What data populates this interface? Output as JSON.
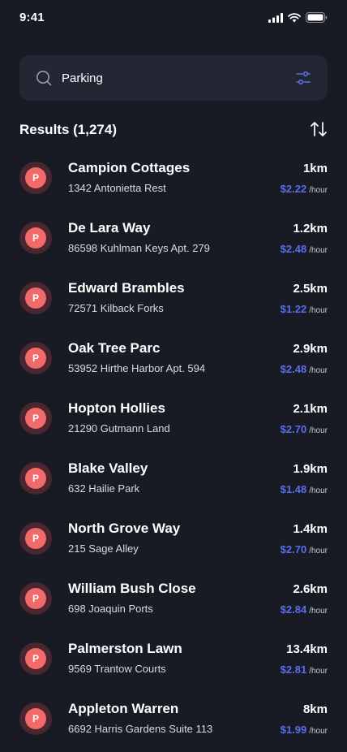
{
  "status_bar": {
    "time": "9:41"
  },
  "search": {
    "value": "Parking"
  },
  "results": {
    "title": "Results (1,274)"
  },
  "colors": {
    "background": "#181b24",
    "card": "#232734",
    "accent": "#5b6cf0",
    "pin": "#f26b6b"
  },
  "icons": {
    "pin_letter": "P"
  },
  "items": [
    {
      "name": "Campion Cottages",
      "address": "1342 Antonietta Rest",
      "distance": "1km",
      "price": "$2.22",
      "unit": "/hour"
    },
    {
      "name": "De Lara Way",
      "address": "86598 Kuhlman Keys Apt. 279",
      "distance": "1.2km",
      "price": "$2.48",
      "unit": "/hour"
    },
    {
      "name": "Edward Brambles",
      "address": "72571 Kilback Forks",
      "distance": "2.5km",
      "price": "$1.22",
      "unit": "/hour"
    },
    {
      "name": "Oak Tree Parc",
      "address": "53952 Hirthe Harbor Apt. 594",
      "distance": "2.9km",
      "price": "$2.48",
      "unit": "/hour"
    },
    {
      "name": "Hopton Hollies",
      "address": "21290 Gutmann Land",
      "distance": "2.1km",
      "price": "$2.70",
      "unit": "/hour"
    },
    {
      "name": "Blake Valley",
      "address": "632 Hailie Park",
      "distance": "1.9km",
      "price": "$1.48",
      "unit": "/hour"
    },
    {
      "name": "North Grove Way",
      "address": "215 Sage Alley",
      "distance": "1.4km",
      "price": "$2.70",
      "unit": "/hour"
    },
    {
      "name": "William Bush Close",
      "address": "698 Joaquin Ports",
      "distance": "2.6km",
      "price": "$2.84",
      "unit": "/hour"
    },
    {
      "name": "Palmerston Lawn",
      "address": "9569 Trantow Courts",
      "distance": "13.4km",
      "price": "$2.81",
      "unit": "/hour"
    },
    {
      "name": "Appleton Warren",
      "address": "6692 Harris Gardens Suite 113",
      "distance": "8km",
      "price": "$1.99",
      "unit": "/hour"
    }
  ]
}
